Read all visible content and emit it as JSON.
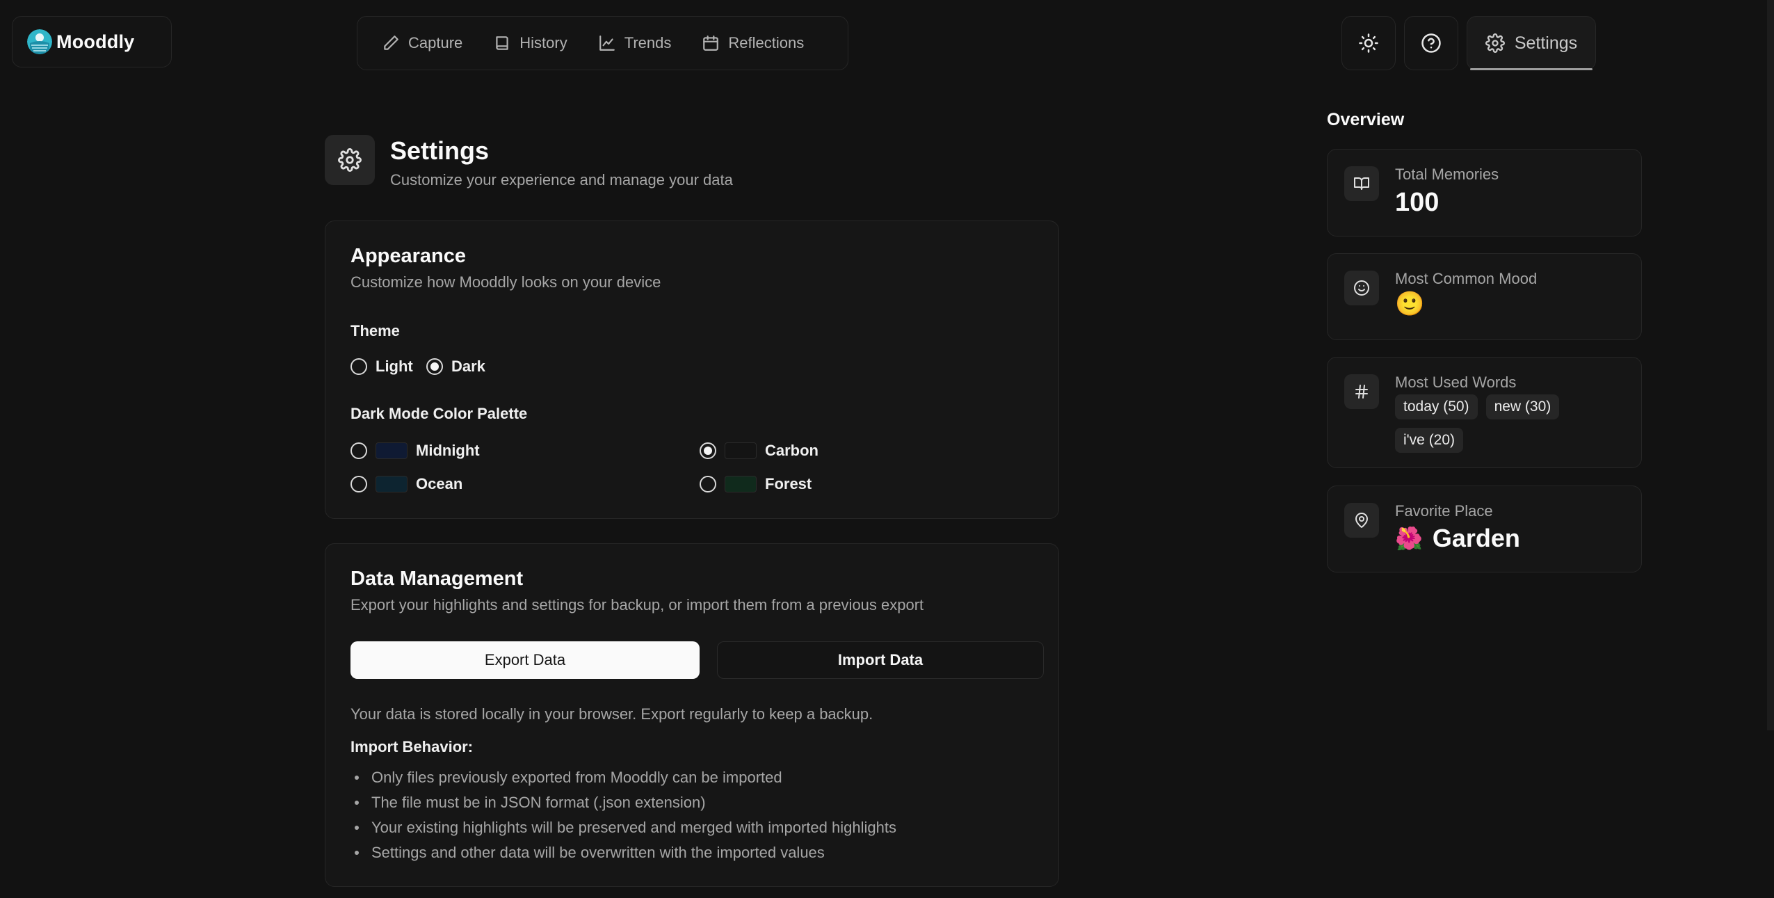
{
  "brand": {
    "name": "Mooddly"
  },
  "nav": {
    "items": [
      {
        "label": "Capture",
        "icon": "pencil-icon"
      },
      {
        "label": "History",
        "icon": "book-icon"
      },
      {
        "label": "Trends",
        "icon": "line-chart-icon"
      },
      {
        "label": "Reflections",
        "icon": "calendar-icon"
      }
    ]
  },
  "toolbar": {
    "settings_label": "Settings"
  },
  "page": {
    "title": "Settings",
    "subtitle": "Customize your experience and manage your data"
  },
  "appearance": {
    "title": "Appearance",
    "description": "Customize how Mooddly looks on your device",
    "theme_label": "Theme",
    "themes": [
      {
        "label": "Light",
        "selected": false
      },
      {
        "label": "Dark",
        "selected": true
      }
    ],
    "palette_label": "Dark Mode Color Palette",
    "palettes": [
      {
        "label": "Midnight",
        "color": "#0f1a33",
        "selected": false
      },
      {
        "label": "Carbon",
        "color": "#141414",
        "selected": true
      },
      {
        "label": "Ocean",
        "color": "#0d2430",
        "selected": false
      },
      {
        "label": "Forest",
        "color": "#102a1c",
        "selected": false
      }
    ]
  },
  "data_management": {
    "title": "Data Management",
    "description": "Export your highlights and settings for backup, or import them from a previous export",
    "export_label": "Export Data",
    "import_label": "Import Data",
    "note": "Your data is stored locally in your browser. Export regularly to keep a backup.",
    "behavior_title": "Import Behavior:",
    "behavior_items": [
      "Only files previously exported from Mooddly can be imported",
      "The file must be in JSON format (.json extension)",
      "Your existing highlights will be preserved and merged with imported highlights",
      "Settings and other data will be overwritten with the imported values"
    ]
  },
  "overview": {
    "title": "Overview",
    "total_memories": {
      "label": "Total Memories",
      "value": "100"
    },
    "common_mood": {
      "label": "Most Common Mood",
      "value": "🙂"
    },
    "used_words": {
      "label": "Most Used Words",
      "words": [
        "today (50)",
        "new (30)",
        "i've (20)"
      ]
    },
    "favorite_place": {
      "label": "Favorite Place",
      "emoji": "🌺",
      "value": "Garden"
    }
  },
  "colors": {
    "background": "#121212",
    "card": "#161616",
    "border": "#262626",
    "accent": "#fafafa"
  }
}
